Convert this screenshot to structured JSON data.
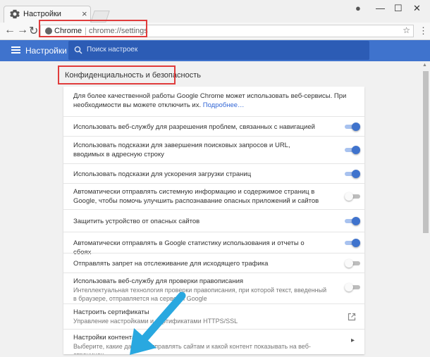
{
  "browser": {
    "tab_title": "Настройки",
    "tab_close": "×",
    "window_controls": {
      "profile": "●",
      "minimize": "—",
      "maximize": "☐",
      "close": "✕"
    },
    "nav": {
      "back": "←",
      "forward": "→",
      "reload": "↻"
    },
    "omnibox": {
      "site_label": "Chrome",
      "url": "chrome://settings",
      "star": "☆"
    },
    "menu": "⋮"
  },
  "header": {
    "title": "Настройки",
    "search_placeholder": "Поиск настроек",
    "color": "#3f73cd"
  },
  "section": {
    "title": "Конфиденциальность и безопасность",
    "intro": "Для более качественной работы Google Chrome может использовать веб-сервисы. При необходимости вы можете отключить их.",
    "intro_link": "Подробнее…",
    "rows": [
      {
        "label": "Использовать веб-службу для разрешения проблем, связанных с навигацией",
        "state": "on"
      },
      {
        "label": "Использовать подсказки для завершения поисковых запросов и URL, вводимых в адресную строку",
        "state": "on"
      },
      {
        "label": "Использовать подсказки для ускорения загрузки страниц",
        "state": "on"
      },
      {
        "label": "Автоматически отправлять системную информацию и содержимое страниц в Google, чтобы помочь улучшить распознавание опасных приложений и сайтов",
        "state": "off"
      },
      {
        "label": "Защитить устройство от опасных сайтов",
        "state": "on"
      },
      {
        "label": "Автоматически отправлять в Google статистику использования и отчеты о сбоях",
        "state": "on"
      },
      {
        "label": "Отправлять запрет на отслеживание для исходящего трафика",
        "state": "off"
      },
      {
        "label": "Использовать веб-службу для проверки правописания",
        "sub": "Интеллектуальная технология проверки правописания, при которой текст, введенный в браузере, отправляется на серверы Google",
        "state": "off"
      },
      {
        "label": "Настроить сертификаты",
        "sub": "Управление настройками и сертификатами HTTPS/SSL",
        "state": "external"
      },
      {
        "label": "Настройки контента",
        "sub": "Выберите, какие данные отправлять сайтам и какой контент показывать на веб-страницах",
        "state": "chevron"
      }
    ]
  },
  "colors": {
    "highlight": "#e03c3c",
    "toggle_on": "#3f73cd",
    "arrow": "#29a8e0"
  },
  "icons": {
    "tab": "gear-icon",
    "search": "search-icon",
    "external": "external-link-icon",
    "chevron": "chevron-right-icon",
    "pointer": "arrow-pointer-icon"
  }
}
